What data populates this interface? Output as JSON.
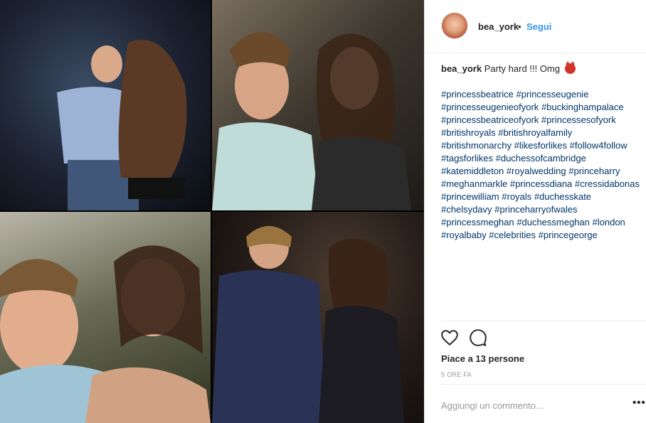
{
  "post": {
    "photo_alt": "photo collage",
    "header": {
      "username": "bea_york",
      "separator": "•",
      "follow_label": "Segui"
    },
    "caption": {
      "username": "bea_york",
      "text": "Party hard !!! Omg",
      "emoji": "devil-emoji",
      "hashtags": [
        "#princessbeatrice",
        "#princesseugenie",
        "#princesseugenieofyork",
        "#buckinghampalace",
        "#princessbeatriceofyork",
        "#princessesofyork",
        "#britishroyals",
        "#britishroyalfamily",
        "#britishmonarchy",
        "#likesforlikes",
        "#follow4follow",
        "#tagsforlikes",
        "#duchessofcambridge",
        "#katemiddleton",
        "#royalwedding",
        "#princeharry",
        "#meghanmarkle",
        "#princessdiana",
        "#cressidabonas",
        "#princewilliam",
        "#royals",
        "#duchesskate",
        "#chelsydavy",
        "#princeharryofwales",
        "#princessmeghan",
        "#duchessmeghan",
        "#london",
        "#royalbaby",
        "#celebrities",
        "#princegeorge"
      ]
    },
    "actions": {
      "like_icon": "heart-icon",
      "comment_icon": "comment-icon"
    },
    "likes_text": "Piace a 13 persone",
    "timestamp": "5 ORE FA",
    "comment_input": {
      "placeholder": "Aggiungi un commento...",
      "value": ""
    },
    "more_label": "•••"
  },
  "colors": {
    "link_blue": "#3897f0",
    "hashtag": "#003569",
    "text": "#262626",
    "muted": "#999999",
    "border": "#efefef"
  }
}
